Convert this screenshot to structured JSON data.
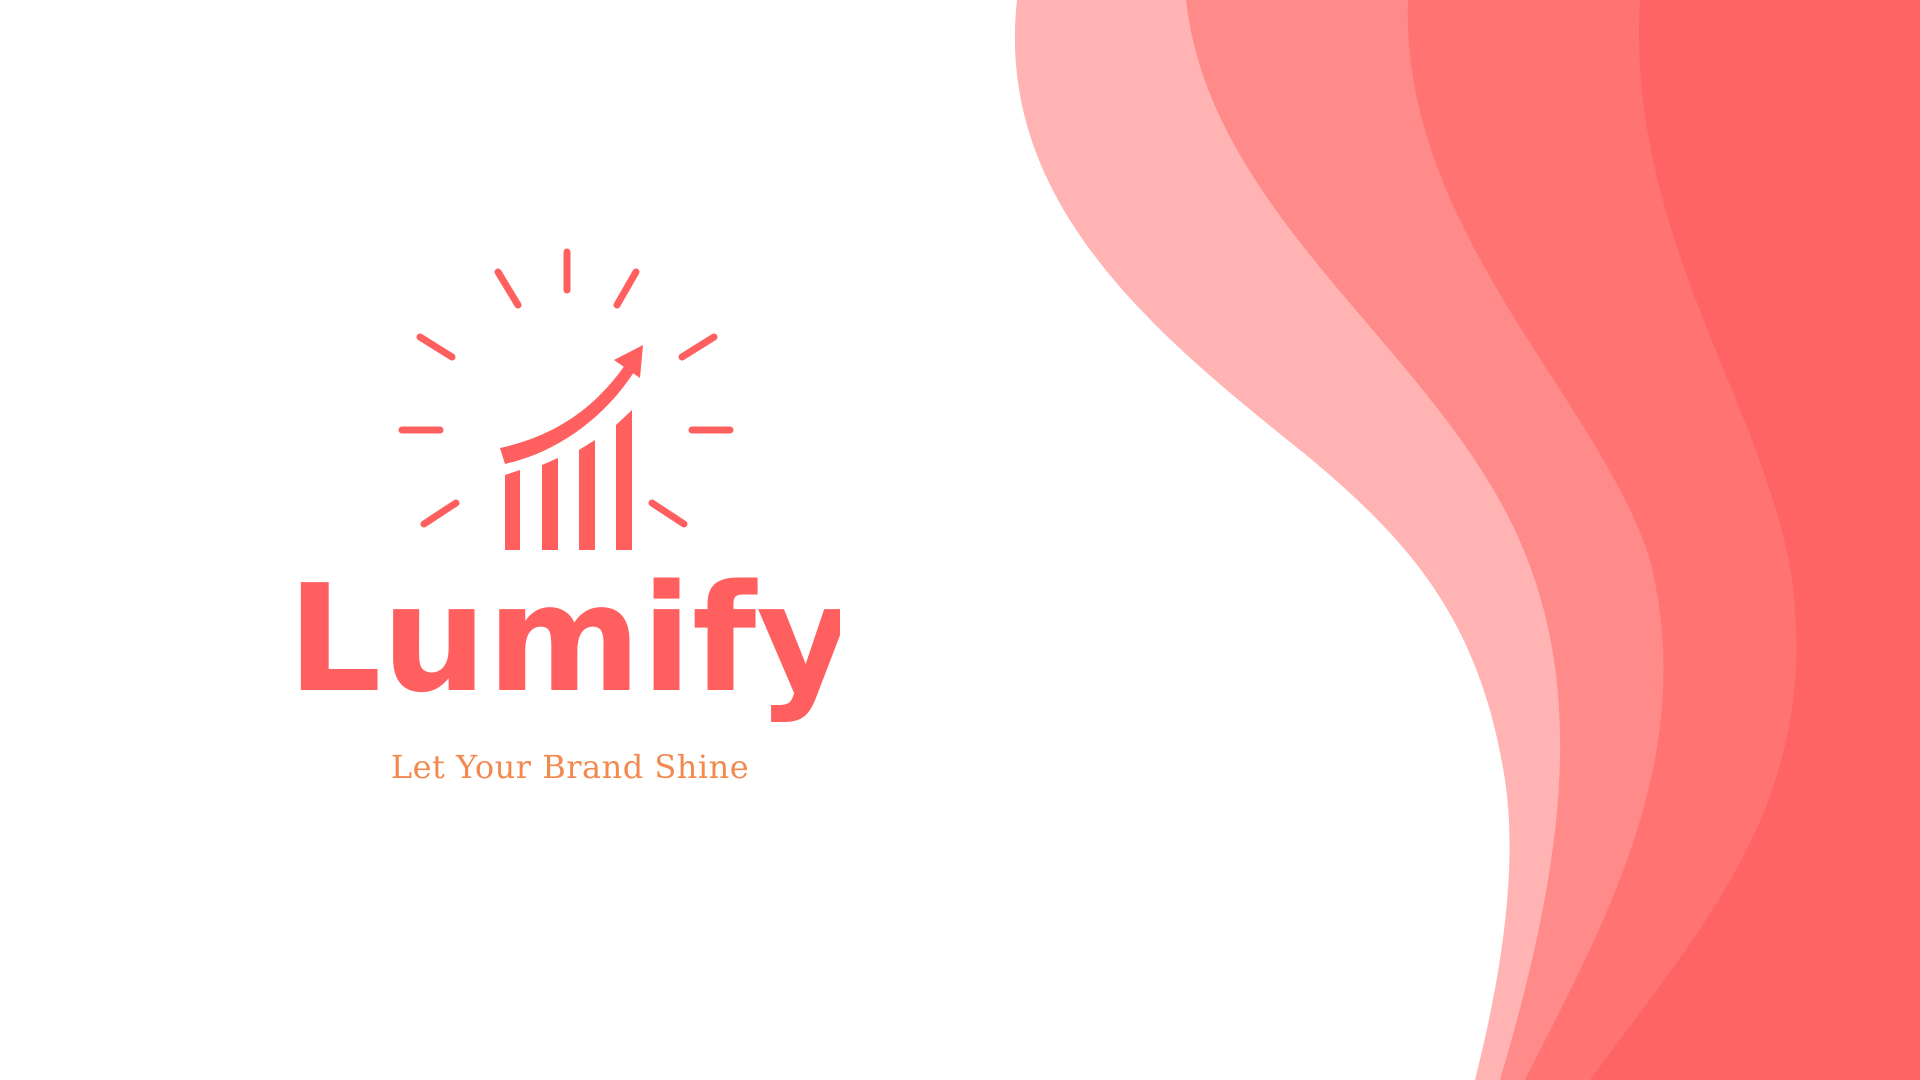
{
  "brand": {
    "name": "Lumify",
    "tagline": "Let Your Brand Shine"
  },
  "logo": {
    "icon": "growth-chart-with-sun-rays-icon"
  },
  "colors": {
    "background": "#ffffff",
    "brand": "#ff5f5f",
    "tagline": "#f2894f",
    "wave_1": "#ffb3b3",
    "wave_2": "#ff8a8a",
    "wave_3": "#ff7373",
    "wave_4": "#ff6464"
  }
}
